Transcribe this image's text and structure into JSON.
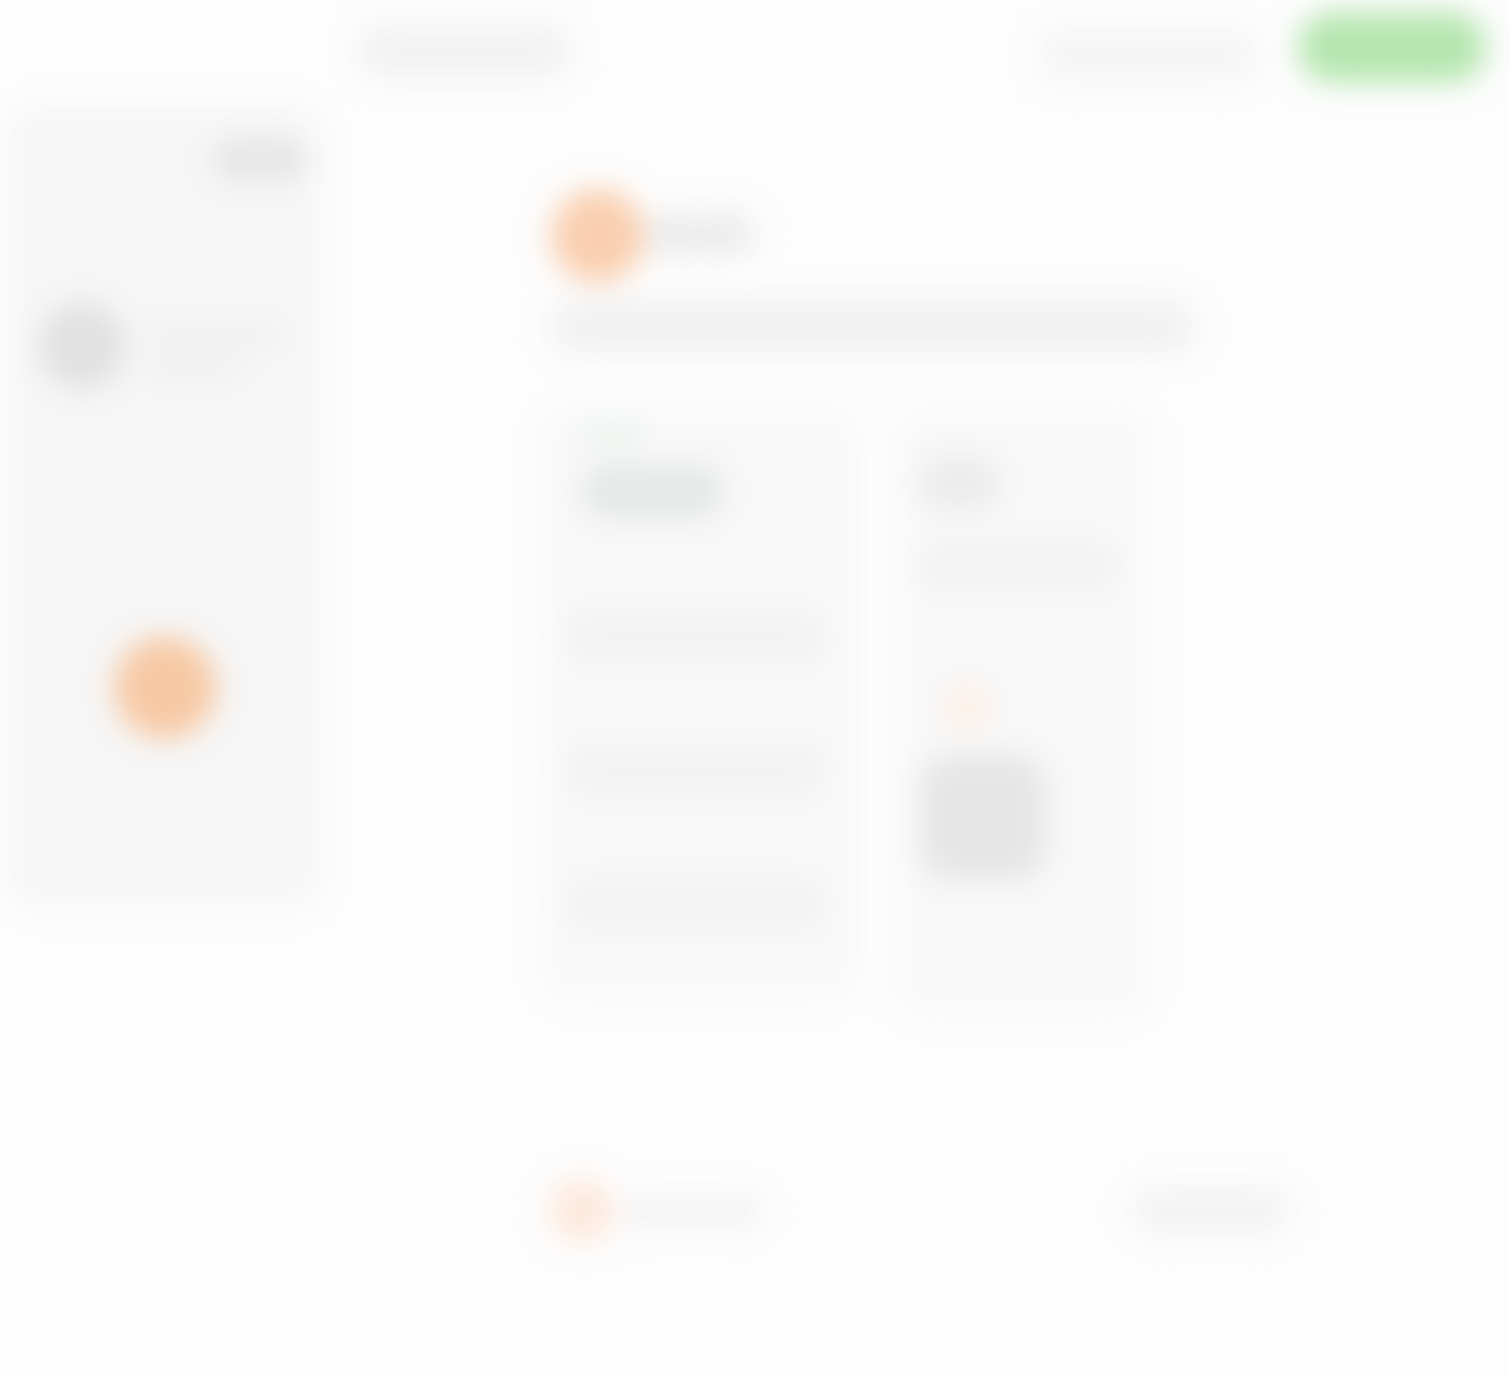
{
  "header": {
    "nav_item_1": "",
    "nav_item_2": "",
    "cta_label": "",
    "cta_color": "#b6e6b0"
  },
  "sidebar": {
    "tag": "",
    "profile_name": "",
    "accent_color": "#f7c9a4"
  },
  "main": {
    "title": "",
    "subtitle": "",
    "accent_color": "#f9cfb0",
    "cards": [
      {
        "title": "",
        "rows": [
          "",
          "",
          ""
        ]
      },
      {
        "title": "",
        "subtitle": ""
      }
    ]
  },
  "footer": {
    "brand": "",
    "right_link": ""
  }
}
